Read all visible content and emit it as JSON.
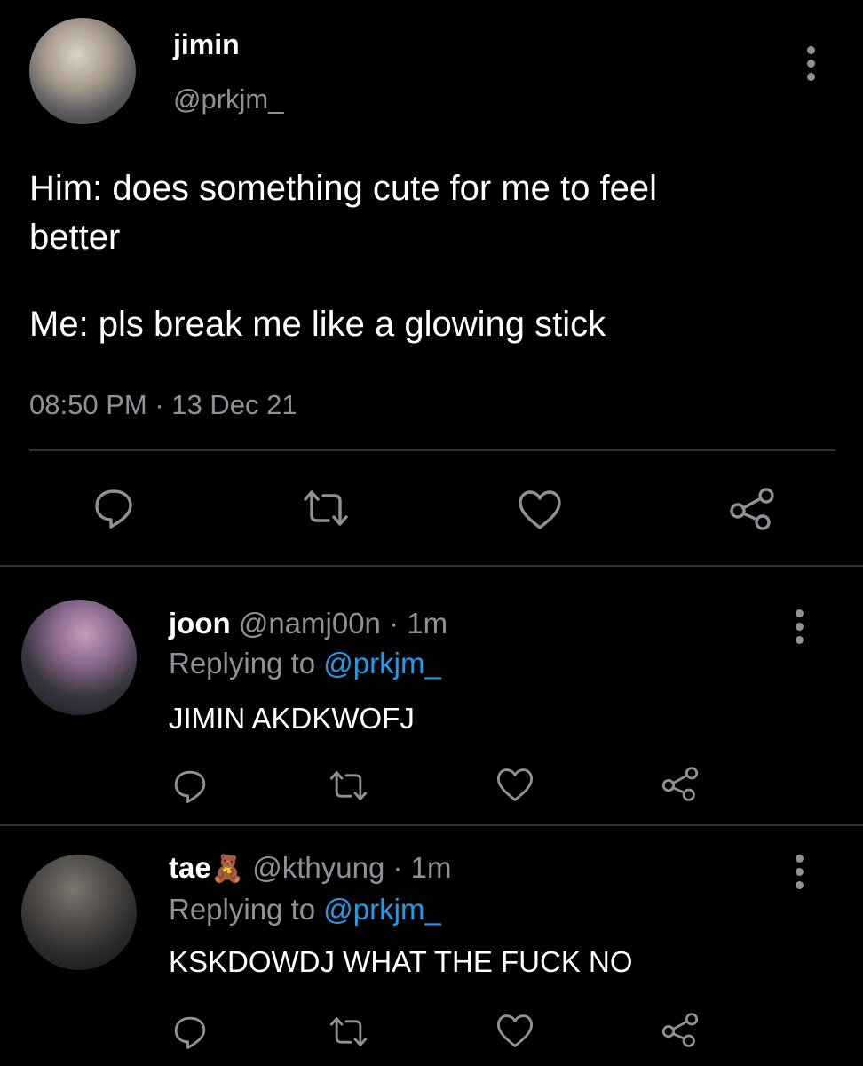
{
  "main_tweet": {
    "display_name": "jimin",
    "handle": "@prkjm_",
    "text_line1": "Him: does something cute for me to feel",
    "text_line2": "better",
    "text_line3": "Me: pls break me like a glowing stick",
    "time": "08:50 PM",
    "separator": "·",
    "date": "13 Dec 21"
  },
  "replies": [
    {
      "display_name": "joon",
      "handle": "@namj00n",
      "separator": "·",
      "time": "1m",
      "replying_prefix": "Replying to",
      "replying_handle": "@prkjm_",
      "text": "JIMIN AKDKWOFJ"
    },
    {
      "display_name": "tae",
      "emoji": "🧸",
      "handle": "@kthyung",
      "separator": "·",
      "time": "1m",
      "replying_prefix": "Replying to",
      "replying_handle": "@prkjm_",
      "text": "KSKDOWDJ WHAT THE FUCK NO"
    }
  ],
  "icons": {
    "reply": "reply-bubble-icon",
    "retweet": "retweet-icon",
    "like": "heart-icon",
    "share": "share-icon",
    "more": "more-vertical-icon"
  },
  "colors": {
    "background": "#000000",
    "text": "#ffffff",
    "muted": "#8e9296",
    "link": "#1d9bf0",
    "divider": "#2f3336"
  }
}
